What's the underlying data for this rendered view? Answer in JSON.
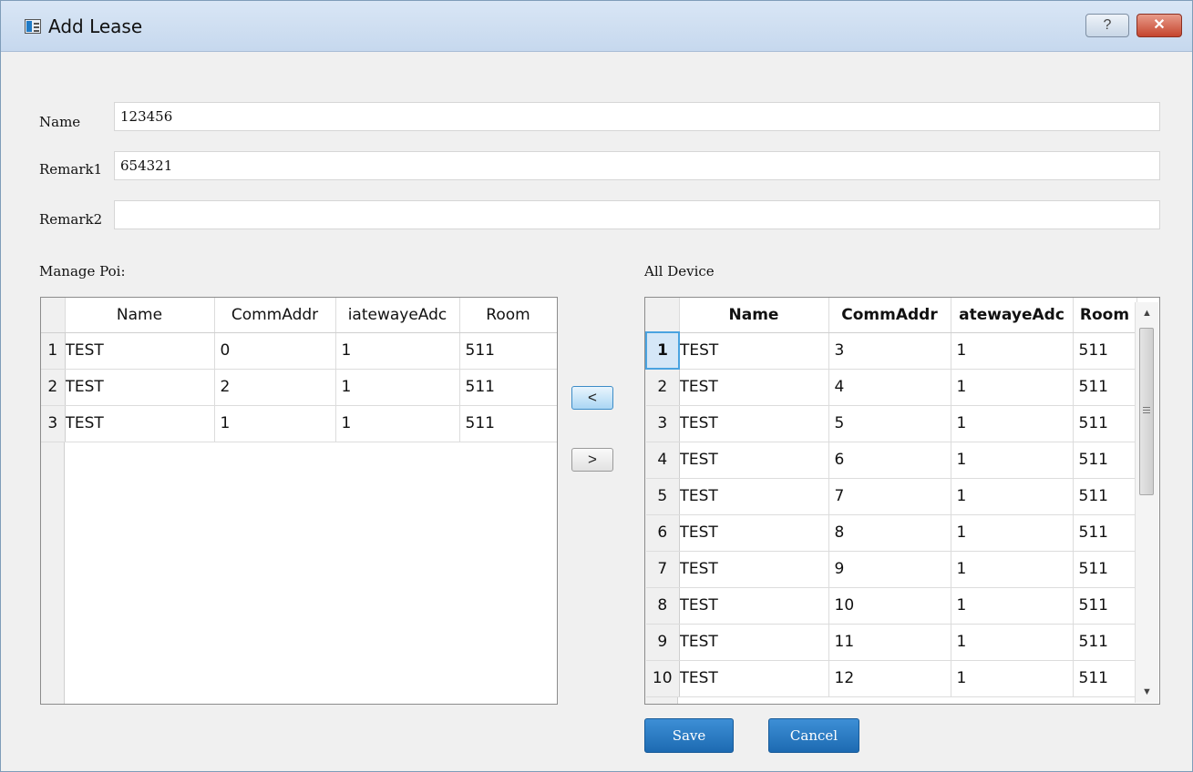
{
  "window": {
    "title": "Add Lease",
    "help_label": "?",
    "close_label": "✕"
  },
  "form": {
    "name_label": "Name",
    "name_value": "123456",
    "remark1_label": "Remark1",
    "remark1_value": "654321",
    "remark2_label": "Remark2",
    "remark2_value": ""
  },
  "manage": {
    "label": "Manage Poi:",
    "columns": [
      "Name",
      "CommAddr",
      "iatewayeAdc",
      "Room"
    ],
    "rows": [
      {
        "n": "1",
        "name": "TEST",
        "addr": "0",
        "gw": "1",
        "room": "511"
      },
      {
        "n": "2",
        "name": "TEST",
        "addr": "2",
        "gw": "1",
        "room": "511"
      },
      {
        "n": "3",
        "name": "TEST",
        "addr": "1",
        "gw": "1",
        "room": "511"
      }
    ]
  },
  "transfer": {
    "add_label": "<",
    "remove_label": ">"
  },
  "devices": {
    "label": "All Device",
    "columns": [
      "Name",
      "CommAddr",
      "atewayeAdc",
      "Room"
    ],
    "rows": [
      {
        "n": "1",
        "name": "TEST",
        "addr": "3",
        "gw": "1",
        "room": "511"
      },
      {
        "n": "2",
        "name": "TEST",
        "addr": "4",
        "gw": "1",
        "room": "511"
      },
      {
        "n": "3",
        "name": "TEST",
        "addr": "5",
        "gw": "1",
        "room": "511"
      },
      {
        "n": "4",
        "name": "TEST",
        "addr": "6",
        "gw": "1",
        "room": "511"
      },
      {
        "n": "5",
        "name": "TEST",
        "addr": "7",
        "gw": "1",
        "room": "511"
      },
      {
        "n": "6",
        "name": "TEST",
        "addr": "8",
        "gw": "1",
        "room": "511"
      },
      {
        "n": "7",
        "name": "TEST",
        "addr": "9",
        "gw": "1",
        "room": "511"
      },
      {
        "n": "8",
        "name": "TEST",
        "addr": "10",
        "gw": "1",
        "room": "511"
      },
      {
        "n": "9",
        "name": "TEST",
        "addr": "11",
        "gw": "1",
        "room": "511"
      },
      {
        "n": "10",
        "name": "TEST",
        "addr": "12",
        "gw": "1",
        "room": "511"
      }
    ],
    "selected_row": "1"
  },
  "scrollbar": {
    "up_label": "▲",
    "down_label": "▼"
  },
  "actions": {
    "save_label": "Save",
    "cancel_label": "Cancel"
  },
  "theme": {
    "accent": "#1f73bd",
    "selection": "#d5e7f7",
    "close_red": "#c5452e"
  }
}
